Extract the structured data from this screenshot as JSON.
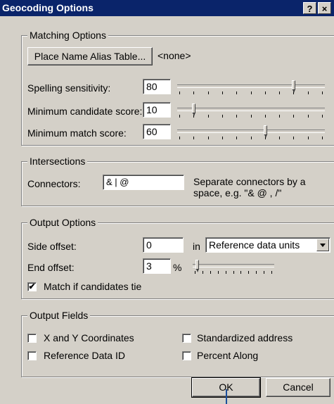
{
  "window": {
    "title": "Geocoding Options",
    "help_button": "?",
    "close_button": "×"
  },
  "matching": {
    "legend": "Matching Options",
    "alias_button": "Place Name Alias Table...",
    "alias_value": "<none>",
    "spelling_label": "Spelling sensitivity:",
    "spelling_value": "80",
    "spelling_level": 0.8,
    "min_candidate_label": "Minimum candidate score:",
    "min_candidate_value": "10",
    "min_candidate_level": 0.1,
    "min_match_label": "Minimum match score:",
    "min_match_value": "60",
    "min_match_level": 0.6
  },
  "intersections": {
    "legend": "Intersections",
    "connectors_label": "Connectors:",
    "connectors_value": "& | @",
    "hint": "Separate connectors by a space, e.g. \"& @ , /\""
  },
  "output": {
    "legend": "Output Options",
    "side_offset_label": "Side offset:",
    "side_offset_value": "0",
    "in_label": "in",
    "units_selected": "Reference data units",
    "end_offset_label": "End offset:",
    "end_offset_value": "3",
    "percent_label": "%",
    "end_offset_level": 0.03,
    "match_tie_label": "Match if candidates tie",
    "match_tie_checked": true
  },
  "fields": {
    "legend": "Output Fields",
    "xy_label": "X and Y Coordinates",
    "std_label": "Standardized address",
    "ref_label": "Reference Data ID",
    "pct_label": "Percent Along"
  },
  "buttons": {
    "ok": "OK",
    "cancel": "Cancel"
  },
  "colors": {
    "titlebar": "#0a246a",
    "face": "#d4d0c8",
    "cursor": "#1c4f9c"
  }
}
